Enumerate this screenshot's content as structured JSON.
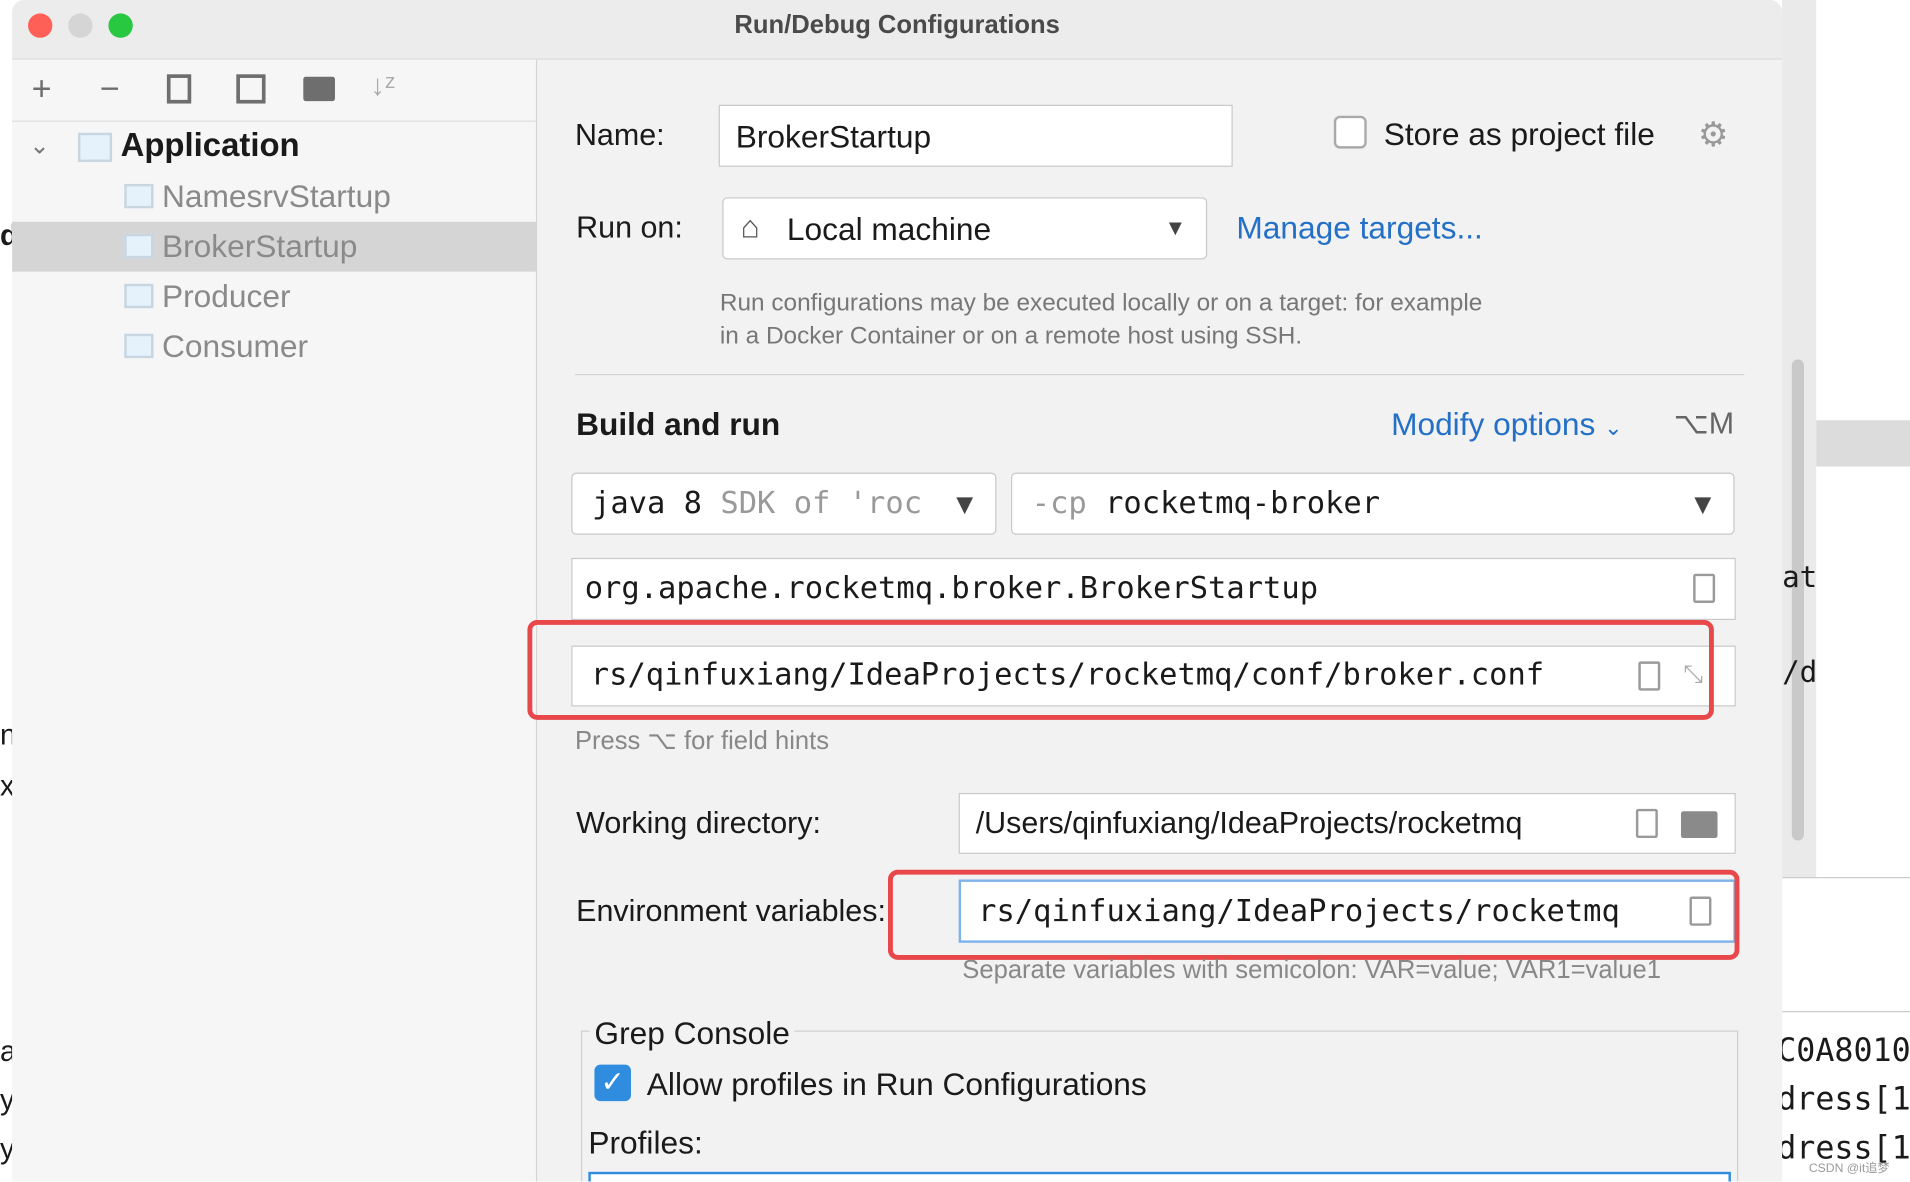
{
  "window": {
    "title": "Run/Debug Configurations"
  },
  "toolbar": {
    "icons": [
      "plus-icon",
      "minus-icon",
      "copy-icon",
      "save-icon",
      "new-folder-icon",
      "sort-icon"
    ]
  },
  "tree": {
    "group": "Application",
    "items": [
      "NamesrvStartup",
      "BrokerStartup",
      "Producer",
      "Consumer"
    ],
    "selected": "BrokerStartup"
  },
  "form": {
    "name_label": "Name:",
    "name_value": "BrokerStartup",
    "store_label": "Store as project file",
    "store_checked": false,
    "run_on_label": "Run on:",
    "run_on_value": "Local machine",
    "manage_targets": "Manage targets...",
    "run_on_hint_1": "Run configurations may be executed locally or on a target: for example",
    "run_on_hint_2": "in a Docker Container or on a remote host using SSH.",
    "build_run_title": "Build and run",
    "modify_options": "Modify options",
    "modify_shortcut": "⌥M",
    "jdk_main": "java 8",
    "jdk_hint": "SDK of 'roc",
    "cp_prefix": "-cp",
    "cp_value": "rocketmq-broker",
    "main_class": "org.apache.rocketmq.broker.BrokerStartup",
    "program_args": "rs/qinfuxiang/IdeaProjects/rocketmq/conf/broker.conf",
    "field_hint": "Press ⌥ for field hints",
    "workdir_label": "Working directory:",
    "workdir_value": "/Users/qinfuxiang/IdeaProjects/rocketmq",
    "env_label": "Environment variables:",
    "env_value": "rs/qinfuxiang/IdeaProjects/rocketmq",
    "env_hint": "Separate variables with semicolon: VAR=value; VAR1=value1",
    "grep_title": "Grep Console",
    "allow_profiles": "Allow profiles in Run Configurations",
    "allow_checked": true,
    "profiles_label": "Profiles:"
  },
  "background": {
    "right_text": [
      "at",
      "/d",
      "C0A8010",
      "dress[1",
      "dress[1"
    ],
    "left_text": [
      "d",
      "n",
      "x",
      "a",
      "y",
      "y"
    ],
    "watermark": "CSDN @it追梦"
  },
  "colors": {
    "accent": "#2470c6",
    "highlight": "#e8484a",
    "checkbox": "#2f8cde"
  }
}
